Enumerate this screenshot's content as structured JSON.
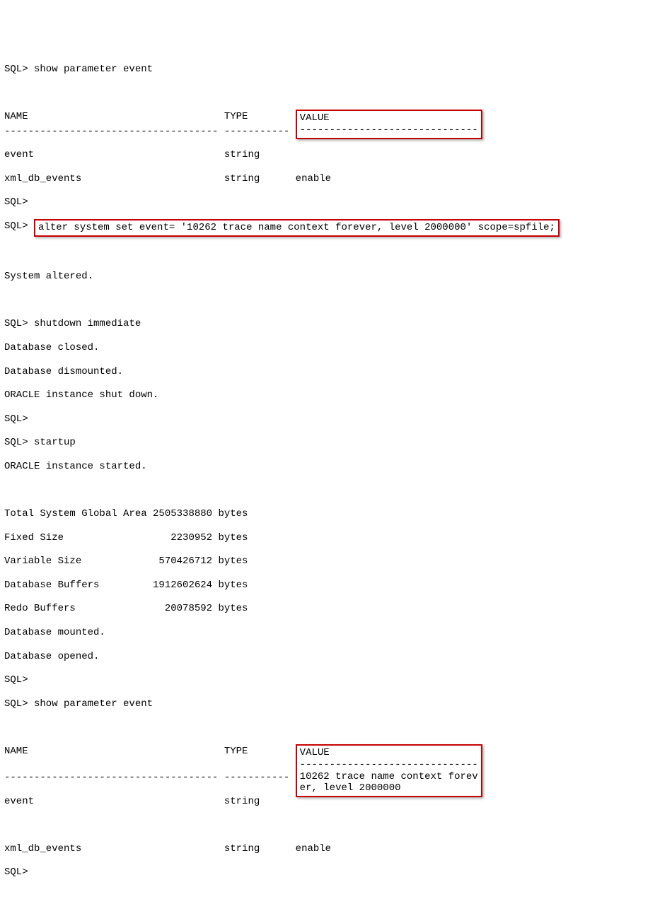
{
  "lines": {
    "l1_prompt": "SQL> show parameter event",
    "hdr1_name": "NAME                                 TYPE        ",
    "hdr1_value": "VALUE",
    "sep1_left": "------------------------------------ ----------- ",
    "sep1_right": "------------------------------",
    "row1a_left": "event                                string      ",
    "row1a_right": "",
    "row1b": "xml_db_events                        string      enable",
    "sql_empty1": "SQL>",
    "alter_prompt": "SQL> ",
    "alter_cmd": "alter system set event= '10262 trace name context forever, level 2000000' scope=spfile;",
    "sys_altered": "System altered.",
    "shutdown": "SQL> shutdown immediate",
    "db_closed": "Database closed.",
    "db_dis": "Database dismounted.",
    "inst_down": "ORACLE instance shut down.",
    "sql_empty2": "SQL>",
    "startup": "SQL> startup",
    "inst_start": "ORACLE instance started.",
    "sga": "Total System Global Area 2505338880 bytes",
    "fix": "Fixed Size                  2230952 bytes",
    "var": "Variable Size             570426712 bytes",
    "buf": "Database Buffers         1912602624 bytes",
    "redo": "Redo Buffers               20078592 bytes",
    "dbm": "Database mounted.",
    "dbo": "Database opened.",
    "sql_empty3": "SQL>",
    "show2": "SQL> show parameter event",
    "hdr2_name": "NAME                                 TYPE        ",
    "hdr2_value": "VALUE",
    "sep2_left": "------------------------------------ ----------- ",
    "sep2_right": "------------------------------",
    "row2a_left": "event                                string      ",
    "row2a_right": "10262 trace name context forev",
    "row2b_left": "                                                 ",
    "row2b_right": "er, level 2000000",
    "row2c": "xml_db_events                        string      enable",
    "sql_empty4": "SQL>"
  }
}
